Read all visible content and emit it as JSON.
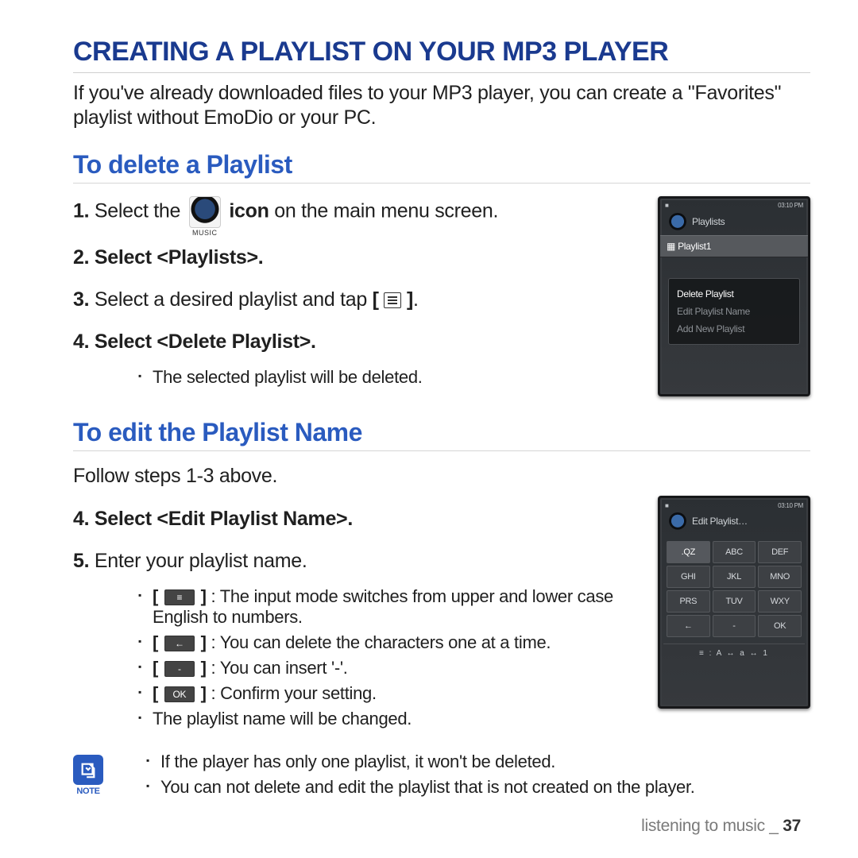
{
  "title": "CREATING A PLAYLIST ON YOUR MP3 PLAYER",
  "intro": "If you've already downloaded files to your MP3 player, you can create a \"Favorites\" playlist without EmoDio or your PC.",
  "section1": {
    "heading": "To delete a Playlist",
    "step1_a": "Select the",
    "step1_b": "icon",
    "step1_c": " on the main menu screen.",
    "music_label": "MUSIC",
    "step2": "Select <Playlists>.",
    "step3_a": "Select a desired playlist and tap ",
    "step3_b": ".",
    "step4": "Select <Delete Playlist>.",
    "step4_sub": "The selected playlist will be deleted."
  },
  "section2": {
    "heading": "To edit the Playlist Name",
    "follow": "Follow steps 1-3 above.",
    "step4": "Select <Edit Playlist Name>.",
    "step5": "Enter your playlist name.",
    "g_mode": " : The input mode switches from upper and lower case English to numbers.",
    "g_back": " : You can delete the characters one at a time.",
    "g_dash": " : You can insert '-'.",
    "g_ok": " : Confirm your setting.",
    "g_done": "The playlist name will be changed."
  },
  "notes": {
    "label": "NOTE",
    "n1": "If the player has only one playlist, it won't be deleted.",
    "n2": "You can not delete and edit the playlist that is not created on the player."
  },
  "footer": {
    "section": "listening to music _ ",
    "page": "37"
  },
  "device1": {
    "time": "03:10 PM",
    "header": "Playlists",
    "selected": "Playlist1",
    "opts": [
      "Delete Playlist",
      "Edit Playlist Name",
      "Add New Playlist"
    ]
  },
  "device2": {
    "time": "03:10 PM",
    "header": "Edit Playlist…",
    "keys": [
      ".QZ",
      "ABC",
      "DEF",
      "GHI",
      "JKL",
      "MNO",
      "PRS",
      "TUV",
      "WXY",
      "←",
      "-",
      "OK"
    ],
    "mode": "≡  : A  ↔  a  ↔  1"
  },
  "glyphs": {
    "mode": "≡",
    "back": "←",
    "dash": "-",
    "ok": "OK"
  }
}
